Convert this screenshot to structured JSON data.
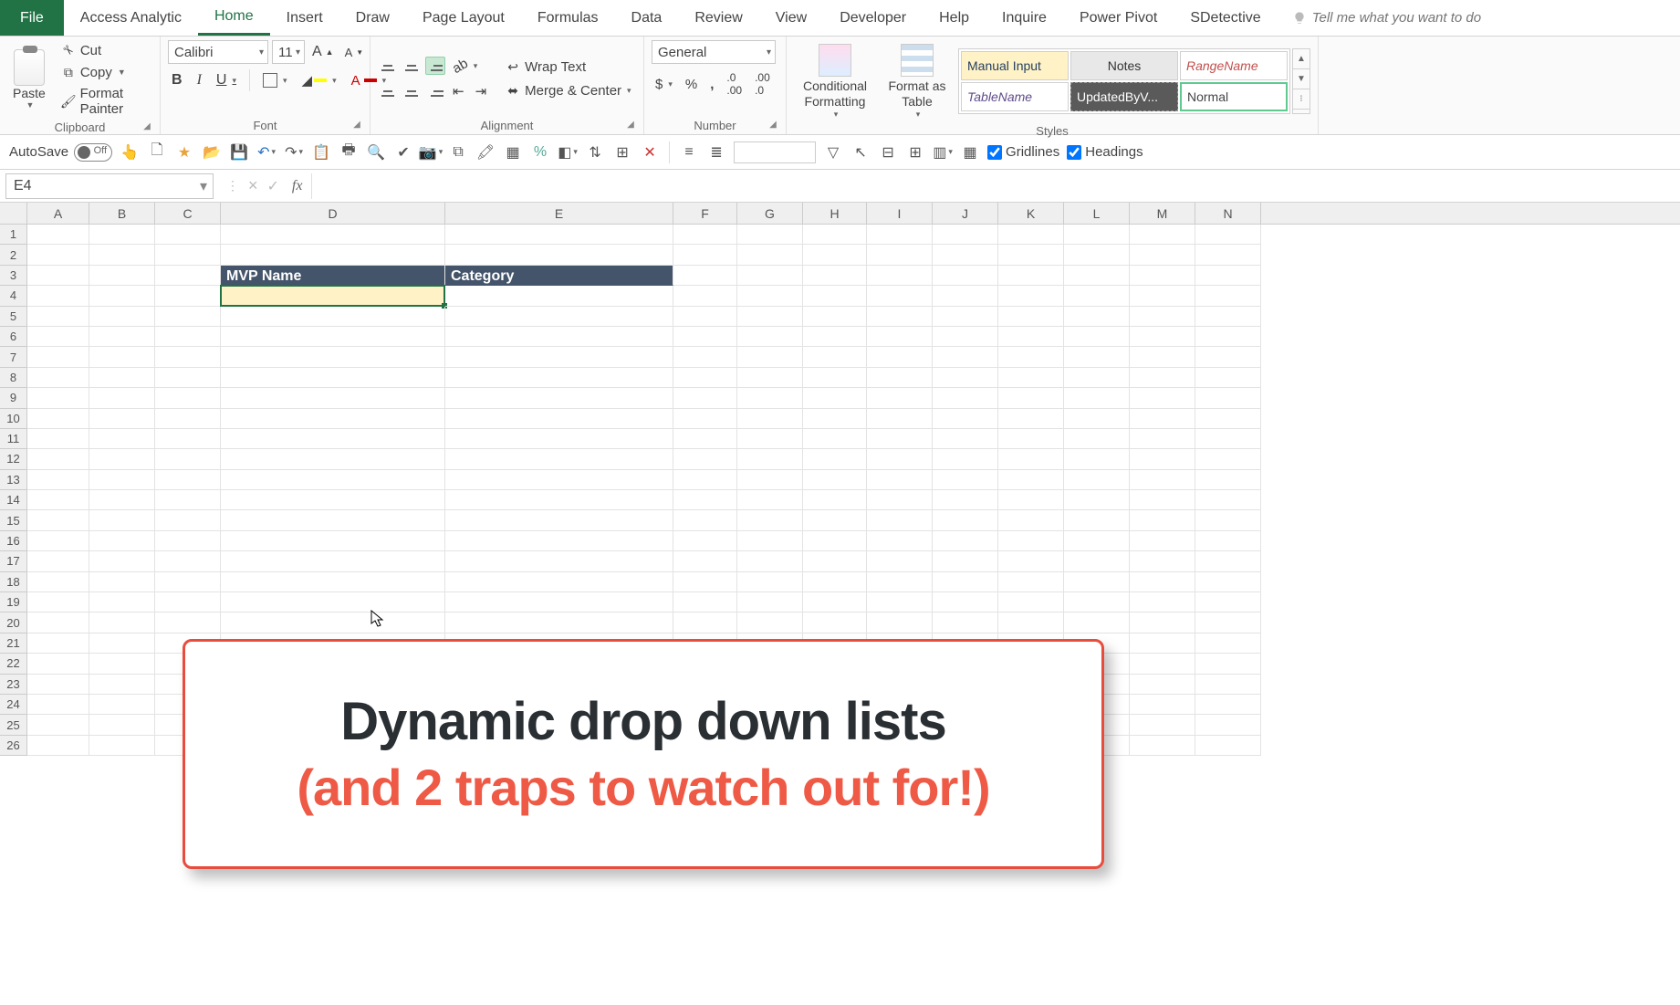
{
  "tabs": {
    "file": "File",
    "items": [
      "Access Analytic",
      "Home",
      "Insert",
      "Draw",
      "Page Layout",
      "Formulas",
      "Data",
      "Review",
      "View",
      "Developer",
      "Help",
      "Inquire",
      "Power Pivot",
      "SDetective"
    ],
    "active_index": 1,
    "tell_me_placeholder": "Tell me what you want to do"
  },
  "ribbon": {
    "clipboard": {
      "label": "Clipboard",
      "paste": "Paste",
      "cut": "Cut",
      "copy": "Copy",
      "format_painter": "Format Painter"
    },
    "font": {
      "label": "Font",
      "name": "Calibri",
      "size": "11"
    },
    "alignment": {
      "label": "Alignment",
      "wrap": "Wrap Text",
      "merge": "Merge & Center"
    },
    "number": {
      "label": "Number",
      "format": "General"
    },
    "styles": {
      "label": "Styles",
      "cond": "Conditional Formatting",
      "table": "Format as Table",
      "gallery": [
        "Manual Input",
        "Notes",
        "RangeName",
        "TableName",
        "UpdatedByV...",
        "Normal"
      ]
    }
  },
  "qat": {
    "autosave": "AutoSave",
    "autosave_state": "Off",
    "gridlines": "Gridlines",
    "headings": "Headings"
  },
  "namebox": "E4",
  "columns": [
    "A",
    "B",
    "C",
    "D",
    "E",
    "F",
    "G",
    "H",
    "I",
    "J",
    "K",
    "L",
    "M",
    "N"
  ],
  "col_widths": [
    "w-a",
    "w-b",
    "w-c",
    "w-d",
    "w-e",
    "w-f",
    "w-g",
    "w-h",
    "w-i",
    "w-j",
    "w-k",
    "w-l",
    "w-m",
    "w-n"
  ],
  "row_count": 26,
  "headers": {
    "d3": "MVP Name",
    "e3": "Category"
  },
  "callout": {
    "line1": "Dynamic drop down lists",
    "line2": "(and 2 traps to watch out for!)"
  }
}
